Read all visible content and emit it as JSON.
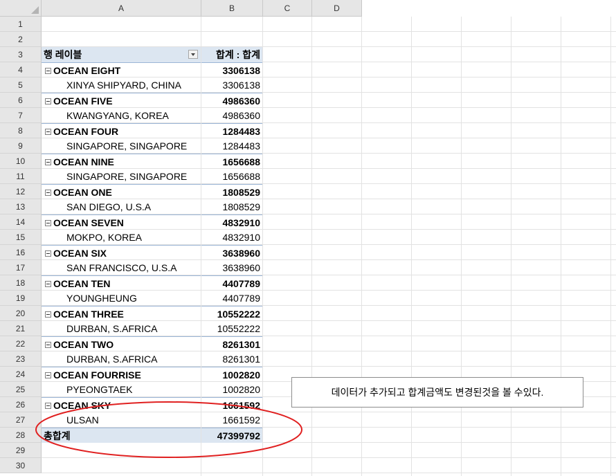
{
  "columns": [
    "A",
    "B",
    "C",
    "D"
  ],
  "row_numbers": [
    "1",
    "2",
    "3",
    "4",
    "5",
    "6",
    "7",
    "8",
    "9",
    "10",
    "11",
    "12",
    "13",
    "14",
    "15",
    "16",
    "17",
    "18",
    "19",
    "20",
    "21",
    "22",
    "23",
    "24",
    "25",
    "26",
    "27",
    "28",
    "29",
    "30"
  ],
  "pivot": {
    "header_label": "행 레이블",
    "header_value": "합계 : 합계",
    "groups": [
      {
        "name": "OCEAN EIGHT",
        "total": "3306138",
        "detail": "XINYA SHIPYARD, CHINA",
        "value": "3306138"
      },
      {
        "name": "OCEAN FIVE",
        "total": "4986360",
        "detail": "KWANGYANG, KOREA",
        "value": "4986360"
      },
      {
        "name": "OCEAN FOUR",
        "total": "1284483",
        "detail": "SINGAPORE, SINGAPORE",
        "value": "1284483"
      },
      {
        "name": "OCEAN NINE",
        "total": "1656688",
        "detail": "SINGAPORE, SINGAPORE",
        "value": "1656688"
      },
      {
        "name": "OCEAN ONE",
        "total": "1808529",
        "detail": "SAN DIEGO, U.S.A",
        "value": "1808529"
      },
      {
        "name": "OCEAN SEVEN",
        "total": "4832910",
        "detail": "MOKPO, KOREA",
        "value": "4832910"
      },
      {
        "name": "OCEAN SIX",
        "total": "3638960",
        "detail": "SAN FRANCISCO, U.S.A",
        "value": "3638960"
      },
      {
        "name": "OCEAN TEN",
        "total": "4407789",
        "detail": "YOUNGHEUNG",
        "value": "4407789"
      },
      {
        "name": "OCEAN THREE",
        "total": "10552222",
        "detail": "DURBAN, S.AFRICA",
        "value": "10552222"
      },
      {
        "name": "OCEAN TWO",
        "total": "8261301",
        "detail": "DURBAN, S.AFRICA",
        "value": "8261301"
      },
      {
        "name": "OCEAN FOURRISE",
        "total": "1002820",
        "detail": "PYEONGTAEK",
        "value": "1002820"
      },
      {
        "name": "OCEAN SKY",
        "total": "1661592",
        "detail": "ULSAN",
        "value": "1661592"
      }
    ],
    "grand_total_label": "총합계",
    "grand_total_value": "47399792"
  },
  "note": "데이터가 추가되고 합계금액도 변경된것을 볼 수있다.",
  "colors": {
    "header_band": "#dce6f1",
    "annotation": "#e02020"
  }
}
